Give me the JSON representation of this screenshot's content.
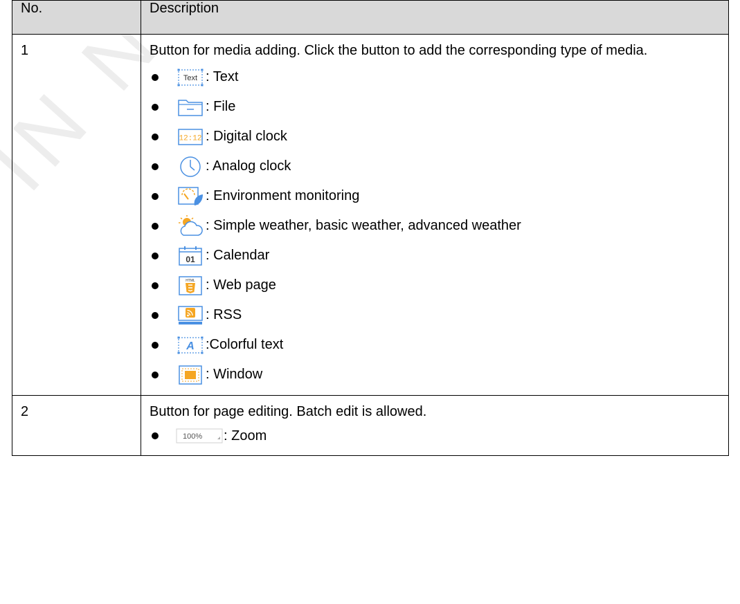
{
  "watermark": "IN NOVASTAR",
  "table": {
    "headers": {
      "no": "No.",
      "description": "Description"
    },
    "rows": [
      {
        "no": "1",
        "intro": "Button for media adding. Click the button to add the corresponding type of media.",
        "items": [
          {
            "icon": "text-icon",
            "icon_text": "Text",
            "label": ": Text"
          },
          {
            "icon": "file-icon",
            "label": ": File"
          },
          {
            "icon": "digital-clock-icon",
            "icon_text": "12:12",
            "label": ": Digital clock"
          },
          {
            "icon": "analog-clock-icon",
            "label": ": Analog clock"
          },
          {
            "icon": "environment-monitoring-icon",
            "label": ": Environment monitoring"
          },
          {
            "icon": "weather-icon",
            "label": ": Simple weather, basic weather, advanced weather"
          },
          {
            "icon": "calendar-icon",
            "icon_text": "01",
            "label": ": Calendar"
          },
          {
            "icon": "html-icon",
            "icon_text": "HTML",
            "label": ": Web page"
          },
          {
            "icon": "rss-icon",
            "label": ": RSS"
          },
          {
            "icon": "colorful-text-icon",
            "icon_text": "A",
            "label": ":Colorful text"
          },
          {
            "icon": "window-icon",
            "label": ": Window"
          }
        ]
      },
      {
        "no": "2",
        "intro": "Button for page editing. Batch edit is allowed.",
        "items": [
          {
            "icon": "zoom-dropdown",
            "icon_text": "100%",
            "label": ": Zoom"
          }
        ]
      }
    ]
  },
  "colors": {
    "header_bg": "#d9d9d9",
    "icon_blue": "#4a90e2",
    "icon_orange": "#f5a623"
  }
}
